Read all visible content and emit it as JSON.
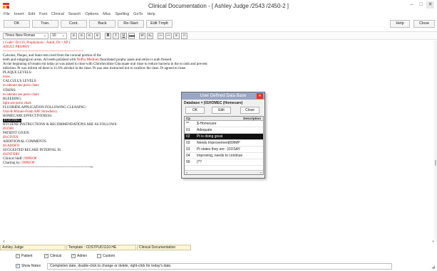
{
  "window": {
    "title": "Clinical Documentation - [ Ashley Judge /2543 /2450-2 ]",
    "minimize": "–",
    "maximize": "□",
    "close": "✕"
  },
  "menu": [
    "File",
    "Insert",
    "Edit",
    "Font",
    "Clinical",
    "Search",
    "Options",
    "Misc",
    "Spelling",
    "GoTo",
    "Help"
  ],
  "toolbar": {
    "buttons": [
      "OK",
      "Tran.",
      "Cont.",
      "Back",
      "Re-Start",
      "Edit Tmplt"
    ],
    "right_buttons": [
      "Help",
      "Close"
    ]
  },
  "format": {
    "font": "Times New Roman",
    "size": "10",
    "buttons": [
      "≡",
      "≡",
      "≡",
      "≡",
      "B",
      "I",
      "U",
      "ABC",
      "x²",
      "x₂",
      "—",
      "—",
      "≡",
      "□"
    ]
  },
  "document": {
    "lines": [
      {
        "parts": [
          {
            "t": "( Code= D1110, Prophylaxis - Adult, Dr.= AP )",
            "c": "red"
          }
        ]
      },
      {
        "parts": [
          {
            "t": "ADULT PROPHY",
            "c": "red"
          }
        ]
      },
      {
        "parts": [
          {
            "t": "--------------------------------------------------------------------",
            "c": "red"
          }
        ]
      },
      {
        "parts": [
          {
            "t": "Calculus, Plaque, and Stain rem oved from the coronal portion of the",
            "c": "blk"
          }
        ]
      },
      {
        "parts": [
          {
            "t": "teeth and subgingival areas.  All teeth polished with ",
            "c": "blk"
          },
          {
            "t": "NuPro Medium",
            "c": "red"
          },
          {
            "t": "  fluoridated prophy paste and entire is outh flossed.",
            "c": "blk"
          }
        ]
      },
      {
        "parts": [
          {
            "t": "At the beginning of treatm ent today pt was asked to rinse with Chlorhexidine Gluconate oral rinse to reduce bacteria in the m outh and prevent",
            "c": "blk"
          }
        ]
      },
      {
        "parts": [
          {
            "t": "infection. Pt was inform ed there is 11.6% alcohol in the rinse. Pt was also instructed not to swallow the rinse. Pt agreed to rinse.",
            "c": "blk"
          }
        ]
      },
      {
        "parts": [
          {
            "t": "PLAQUE LEVELS:",
            "c": "blk"
          }
        ]
      },
      {
        "parts": [
          {
            "t": "none.",
            "c": "red"
          }
        ]
      },
      {
        "parts": [
          {
            "t": "CALCULUS LEVELS:",
            "c": "blk"
          }
        ]
      },
      {
        "parts": [
          {
            "t": "m oderate see perio chart.",
            "c": "red"
          }
        ]
      },
      {
        "parts": [
          {
            "t": "STAINS:",
            "c": "blk"
          }
        ]
      },
      {
        "parts": [
          {
            "t": "m oderate see perio chart.",
            "c": "red"
          }
        ]
      },
      {
        "parts": [
          {
            "t": "BLEEDING:",
            "c": "blk"
          }
        ]
      },
      {
        "parts": [
          {
            "t": "light see perio chart.",
            "c": "red"
          }
        ]
      },
      {
        "parts": [
          {
            "t": "FLUORIDE APPLICATION FOLLOWING CLEANING:",
            "c": "blk"
          }
        ]
      },
      {
        "parts": [
          {
            "t": "Oral-B Minute-Foam  APF Strawberry.",
            "c": "red"
          }
        ]
      },
      {
        "parts": [
          {
            "t": "HOMECARE EFFECTIVENESS:",
            "c": "blk"
          }
        ]
      },
      {
        "parts": [
          {
            "t": "|01HOMEC",
            "c": "hl"
          }
        ]
      },
      {
        "parts": [
          {
            "t": "HYGIENE INSTRUCTIONS & RECOMMENDATIONS ARE AS FOLLOWS:",
            "c": "blk"
          }
        ]
      },
      {
        "parts": [
          {
            "t": "|01OHI",
            "c": "red"
          }
        ]
      },
      {
        "parts": [
          {
            "t": "PATIENT GIVEN:",
            "c": "blk"
          }
        ]
      },
      {
        "parts": [
          {
            "t": "|01GIVEN",
            "c": "red"
          }
        ]
      },
      {
        "parts": [
          {
            "t": "ADDITIONAL COMMENTS:",
            "c": "blk"
          }
        ]
      },
      {
        "parts": [
          {
            "t": "|01ADDITI",
            "c": "red"
          }
        ]
      },
      {
        "parts": [
          {
            "t": "SUGGESTED RECARE INTERVAL IS:",
            "c": "blk"
          }
        ]
      },
      {
        "parts": [
          {
            "t": "|01INTERV",
            "c": "red"
          }
        ]
      },
      {
        "parts": [
          {
            "t": "Clinical Staff:  ",
            "c": "blk"
          },
          {
            "t": "|99PEOP",
            "c": "red"
          }
        ]
      },
      {
        "parts": [
          {
            "t": "Charting by:  ",
            "c": "blk"
          },
          {
            "t": "|99PEOP",
            "c": "red"
          }
        ]
      },
      {
        "parts": [
          {
            "t": "--------------------------------------------------------------------------o",
            "c": "blk"
          }
        ]
      }
    ]
  },
  "dialog": {
    "title": "User Defined Data Base",
    "close": "✕",
    "database": "Database = |01HOMEC (Homecare)",
    "buttons": [
      "OK",
      "Edit",
      "Close"
    ],
    "headers": {
      "col1": "Cp",
      "col2": "Description"
    },
    "rows": [
      {
        "code": "**",
        "desc": "$-Homecare"
      },
      {
        "code": "01",
        "desc": "Adequate"
      },
      {
        "code": "02",
        "desc": "Pt is doing great"
      },
      {
        "code": "03",
        "desc": "Needs Improvement|69IMP"
      },
      {
        "code": "03",
        "desc": "Pt states they are : |01ISAY"
      },
      {
        "code": "04",
        "desc": "Improving, needs to continue"
      },
      {
        "code": "99",
        "desc": "|??"
      }
    ],
    "selected_index": 2,
    "scroll_left": "<",
    "scroll_right": ">"
  },
  "status": {
    "patient": "Ashley Judge",
    "template": "Template : CDSTPUD1110.HE",
    "module": "Clinical Documentation",
    "scroll_left": "<",
    "scroll_right": ">"
  },
  "checkboxes": [
    {
      "label": "Patient",
      "checked": true
    },
    {
      "label": "Clinical",
      "checked": true
    },
    {
      "label": "Admin",
      "checked": true
    },
    {
      "label": "Custom",
      "checked": false
    }
  ],
  "notes": {
    "label": "Show Notes",
    "checked": true,
    "text": "Completion date, double-click to change or delete, right-click for today's date."
  }
}
